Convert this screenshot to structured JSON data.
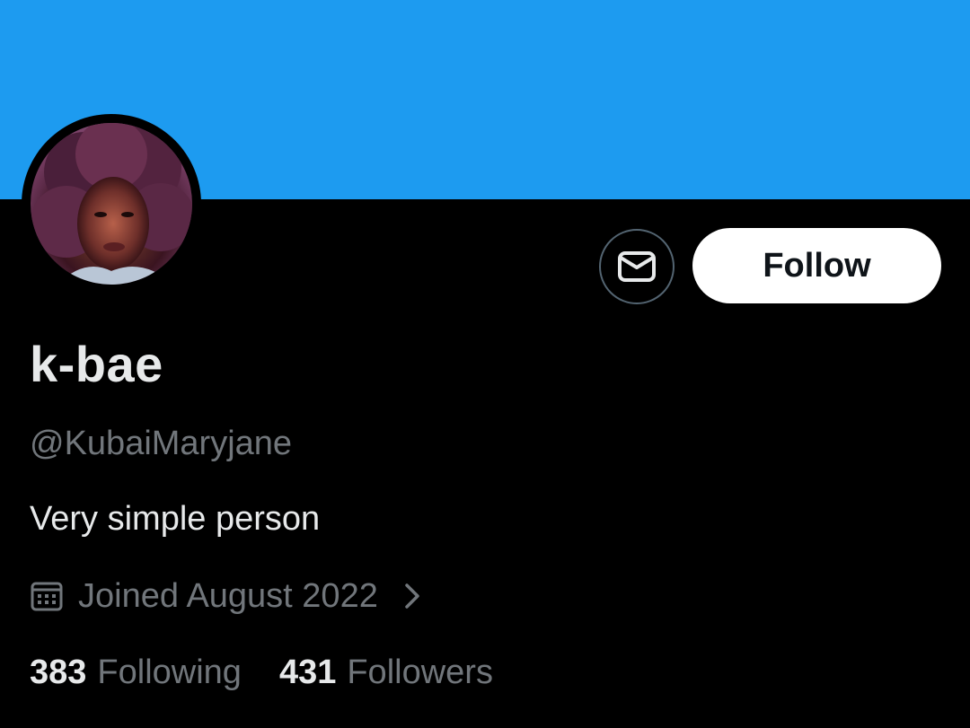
{
  "colors": {
    "banner": "#1d9bf0",
    "background": "#000000",
    "follow_button_bg": "#ffffff",
    "follow_button_text": "#0f1419",
    "primary_text": "#e7e9ea",
    "secondary_text": "#71767b",
    "button_border": "#536471"
  },
  "profile": {
    "display_name": "k-bae",
    "handle": "@KubaiMaryjane",
    "bio": "Very simple person",
    "joined": "Joined August 2022"
  },
  "actions": {
    "message_icon": "envelope-icon",
    "follow_label": "Follow"
  },
  "stats": [
    {
      "count": "383",
      "label": "Following"
    },
    {
      "count": "431",
      "label": "Followers"
    }
  ],
  "icons": {
    "joined": "calendar-icon",
    "more": "chevron-right-icon"
  }
}
